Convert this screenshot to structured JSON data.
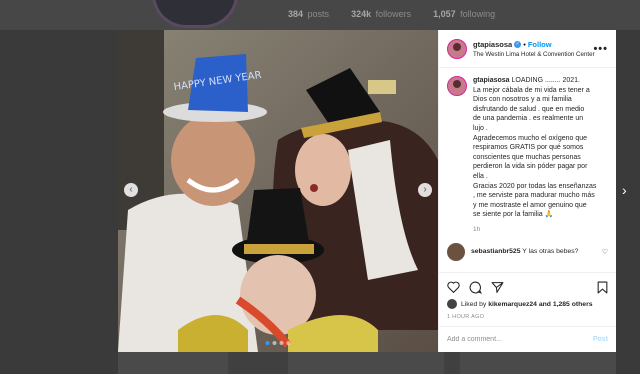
{
  "profile": {
    "stats": [
      {
        "value": "384",
        "label": "posts"
      },
      {
        "value": "324k",
        "label": "followers"
      },
      {
        "value": "1,057",
        "label": "following"
      }
    ]
  },
  "post": {
    "username": "gtapiasosa",
    "follow_label": "Follow",
    "location": "The Westin Lima Hotel & Convention Center",
    "more_label": "•••",
    "caption_lines": [
      "LOADING ........ 2021.",
      "La mejor cábala de mi vida es tener a",
      "Dios con nosotros y a mi familia",
      "disfrutando de salud . que en medio",
      "de una pandemia . es realmente un",
      "lujo .",
      "Agradecemos mucho el oxígeno que",
      "respiramos GRATIS por qué somos",
      "conscientes que muchas personas",
      "perdieron la vida sin póder pagar por",
      "ella .",
      "Gracias 2020 por todas las enseñanzas",
      ", me serviste para madurar mucho más",
      "y me mostraste el amor genuino que",
      "se siente por la familia 🙏"
    ],
    "caption_time": "1h",
    "comment": {
      "user": "sebastianbr525",
      "text": "Y las otras bebes?"
    },
    "likes": {
      "prefix": "Liked by",
      "user": "kikemarquez24",
      "suffix": "and 1,285 others"
    },
    "posted_time": "1 HOUR AGO",
    "add_comment_placeholder": "Add a comment...",
    "post_label": "Post"
  },
  "photo": {
    "hat_text": "HAPPY NEW YEAR",
    "carousel_dots": 4,
    "active_dot": 0
  },
  "colors": {
    "accent": "#0095f6",
    "verified": "#3897f0"
  },
  "icons": [
    "chevron-left-icon",
    "chevron-right-icon",
    "heart-icon",
    "comment-icon",
    "share-icon",
    "bookmark-icon",
    "verified-icon",
    "more-icon"
  ]
}
